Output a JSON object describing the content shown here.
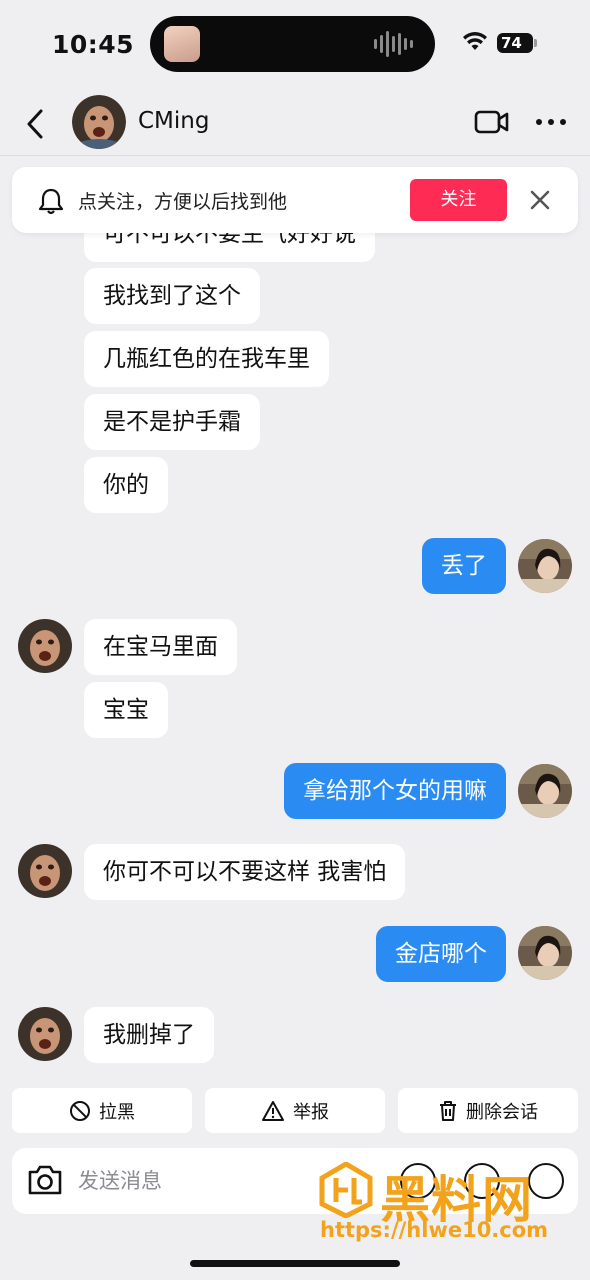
{
  "status": {
    "time": "10:45",
    "battery": "74"
  },
  "header": {
    "name": "CMing"
  },
  "banner": {
    "text": "点关注，方便以后找到他",
    "follow_label": "关注"
  },
  "messages": [
    {
      "side": "in",
      "text": "可不可以不要生气好好说"
    },
    {
      "side": "in",
      "text": "我找到了这个"
    },
    {
      "side": "in",
      "text": "几瓶红色的在我车里"
    },
    {
      "side": "in",
      "text": "是不是护手霜"
    },
    {
      "side": "in",
      "text": "你的"
    },
    {
      "side": "out",
      "text": "丢了"
    },
    {
      "side": "in",
      "text": "在宝马里面"
    },
    {
      "side": "in",
      "text": "宝宝"
    },
    {
      "side": "out",
      "text": "拿给那个女的用嘛"
    },
    {
      "side": "in",
      "text": "你可不可以不要这样 我害怕"
    },
    {
      "side": "out",
      "text": "金店哪个"
    },
    {
      "side": "in",
      "text": "我删掉了"
    }
  ],
  "actions": {
    "block": "拉黑",
    "report": "举报",
    "delete": "删除会话"
  },
  "input": {
    "placeholder": "发送消息"
  },
  "watermark": {
    "brand": "黑料网",
    "url": "https://hlwe10.com"
  },
  "colors": {
    "accent_blue": "#2a8cf2",
    "follow_red": "#fe2c55",
    "background": "#efeff2"
  }
}
